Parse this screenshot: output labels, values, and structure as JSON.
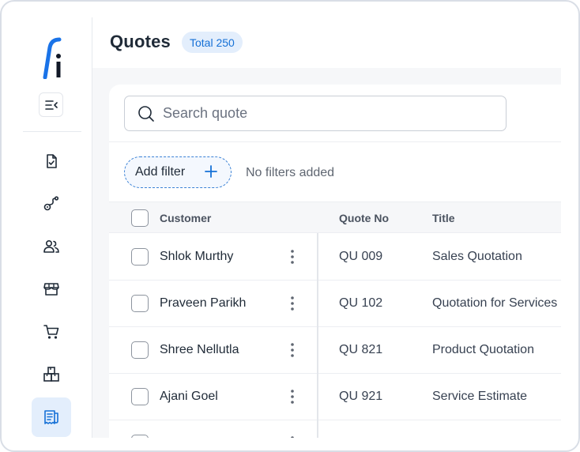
{
  "sidebar": {
    "logo_alt": "fi",
    "nav_items": [
      {
        "name": "tasks",
        "icon": "document-check-icon",
        "active": false
      },
      {
        "name": "route",
        "icon": "route-icon",
        "active": false
      },
      {
        "name": "users",
        "icon": "users-icon",
        "active": false
      },
      {
        "name": "store",
        "icon": "store-icon",
        "active": false
      },
      {
        "name": "cart",
        "icon": "cart-icon",
        "active": false
      },
      {
        "name": "inventory",
        "icon": "boxes-icon",
        "active": false
      },
      {
        "name": "quotes",
        "icon": "receipt-icon",
        "active": true
      }
    ]
  },
  "header": {
    "title": "Quotes",
    "total_badge": "Total 250"
  },
  "search": {
    "placeholder": "Search quote",
    "value": ""
  },
  "filters": {
    "add_label": "Add filter",
    "status": "No filters added"
  },
  "table": {
    "columns": [
      "Customer",
      "Quote No",
      "Title"
    ],
    "rows": [
      {
        "customer": "Shlok Murthy",
        "quote_no": "QU 009",
        "title": "Sales Quotation"
      },
      {
        "customer": "Praveen Parikh",
        "quote_no": "QU 102",
        "title": "Quotation for Services"
      },
      {
        "customer": "Shree Nellutla",
        "quote_no": "QU 821",
        "title": "Product Quotation"
      },
      {
        "customer": "Ajani Goel",
        "quote_no": "QU 921",
        "title": "Service Estimate"
      }
    ]
  },
  "colors": {
    "accent": "#1570d6",
    "accent_light": "#e3eefc",
    "logo_blue": "#1a73e8"
  }
}
